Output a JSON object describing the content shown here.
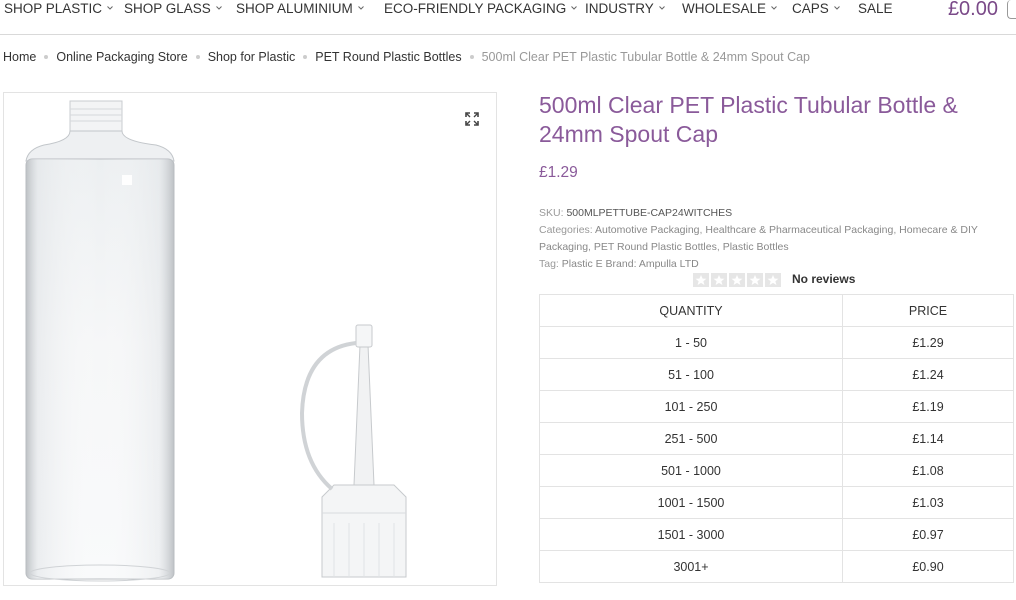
{
  "nav": {
    "items": [
      {
        "label": "SHOP PLASTIC",
        "dropdown": true
      },
      {
        "label": "SHOP GLASS",
        "dropdown": true
      },
      {
        "label": "SHOP ALUMINIUM",
        "dropdown": true
      },
      {
        "label": "ECO-FRIENDLY PACKAGING",
        "dropdown": true
      },
      {
        "label": "INDUSTRY",
        "dropdown": true
      },
      {
        "label": "WHOLESALE",
        "dropdown": true
      },
      {
        "label": "CAPS",
        "dropdown": true
      },
      {
        "label": "SALE",
        "dropdown": false
      }
    ],
    "cart_total": "£0.00"
  },
  "breadcrumb": {
    "links": [
      "Home",
      "Online Packaging Store",
      "Shop for Plastic",
      "PET Round Plastic Bottles"
    ],
    "current": "500ml Clear PET Plastic Tubular Bottle & 24mm Spout Cap"
  },
  "product": {
    "title": "500ml Clear PET Plastic Tubular Bottle & 24mm Spout Cap",
    "price": "£1.29",
    "sku_label": "SKU:",
    "sku": "500MLPETTUBE-CAP24WITCHES",
    "categories_label": "Categories:",
    "categories": [
      "Automotive Packaging",
      "Healthcare & Pharmaceutical Packaging",
      "Homecare & DIY Packaging",
      "PET Round Plastic Bottles",
      "Plastic Bottles"
    ],
    "tag_label": "Tag:",
    "tag": "Plastic E Brand:",
    "brand": "Ampulla LTD",
    "reviews": "No reviews",
    "rating": 0
  },
  "pricing": {
    "headers": [
      "QUANTITY",
      "PRICE"
    ],
    "rows": [
      [
        "1 - 50",
        "£1.29"
      ],
      [
        "51 - 100",
        "£1.24"
      ],
      [
        "101 - 250",
        "£1.19"
      ],
      [
        "251 - 500",
        "£1.14"
      ],
      [
        "501 - 1000",
        "£1.08"
      ],
      [
        "1001 - 1500",
        "£1.03"
      ],
      [
        "1501 - 3000",
        "£0.97"
      ],
      [
        "3001+",
        "£0.90"
      ]
    ]
  },
  "colors": {
    "accent": "#8a5a9a",
    "border": "#e3e3e3",
    "muted": "#999999"
  },
  "icons": {
    "zoom": "expand-icon",
    "chevron": "chevron-down-icon",
    "star": "star-icon"
  }
}
